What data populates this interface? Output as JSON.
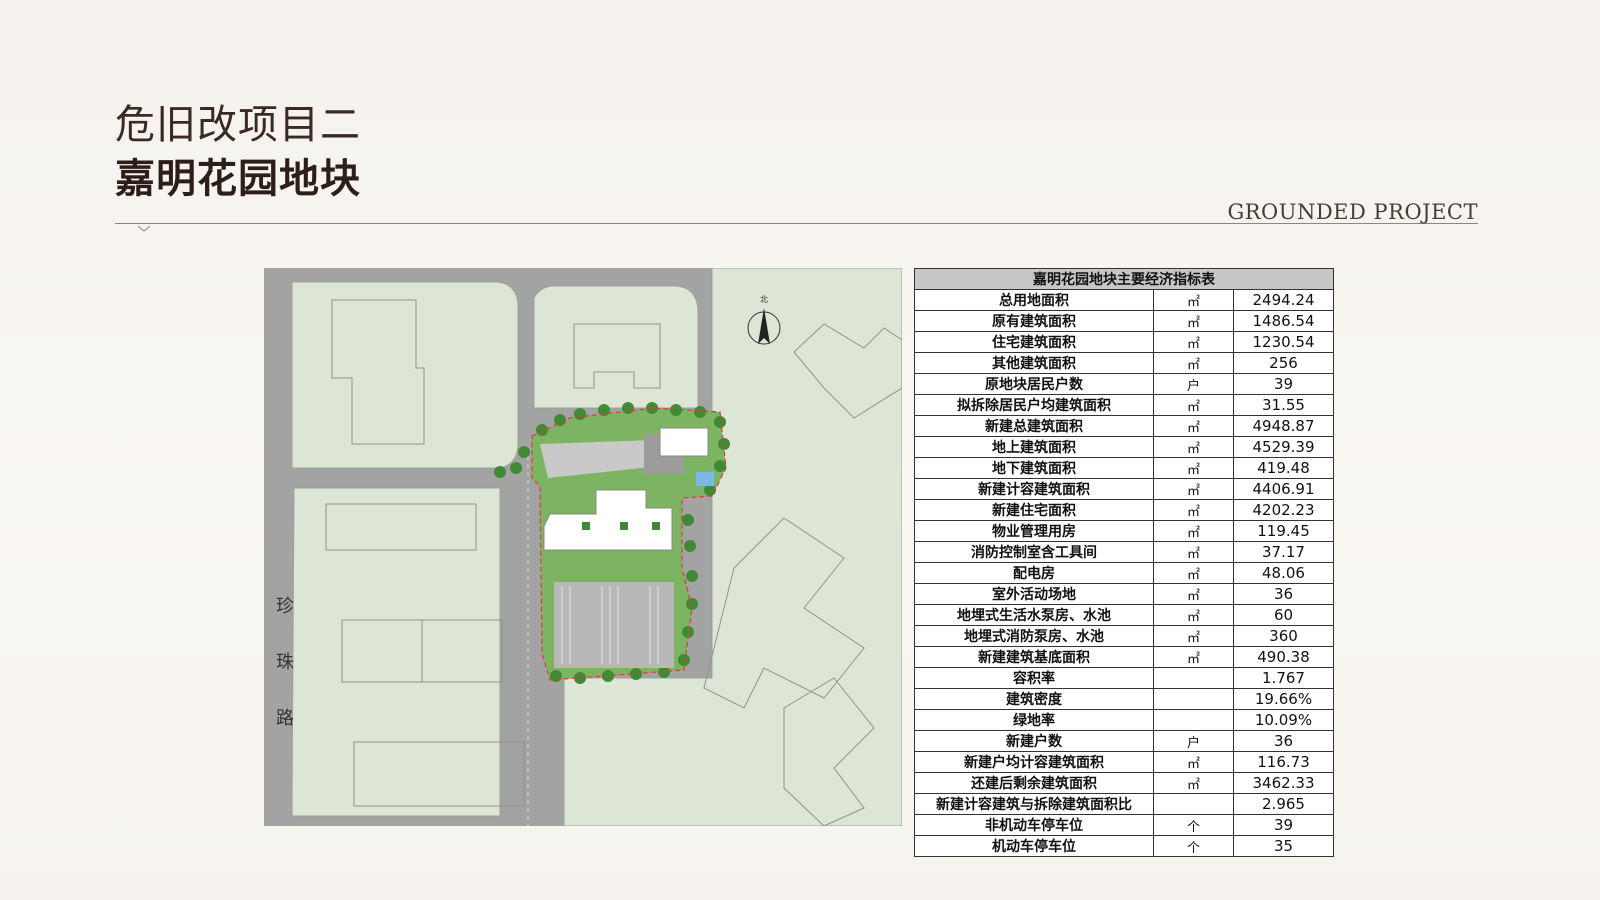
{
  "header": {
    "subtitle": "危旧改项目二",
    "title": "嘉明花园地块",
    "brand": "GROUNDED PROJECT"
  },
  "map": {
    "north_label": "北",
    "road_name_chars": [
      "珍",
      "珠",
      "路"
    ]
  },
  "table": {
    "title": "嘉明花园地块主要经济指标表",
    "rows": [
      {
        "name": "总用地面积",
        "unit": "㎡",
        "value": "2494.24"
      },
      {
        "name": "原有建筑面积",
        "unit": "㎡",
        "value": "1486.54"
      },
      {
        "name": "住宅建筑面积",
        "unit": "㎡",
        "value": "1230.54"
      },
      {
        "name": "其他建筑面积",
        "unit": "㎡",
        "value": "256"
      },
      {
        "name": "原地块居民户数",
        "unit": "户",
        "value": "39"
      },
      {
        "name": "拟拆除居民户均建筑面积",
        "unit": "㎡",
        "value": "31.55"
      },
      {
        "name": "新建总建筑面积",
        "unit": "㎡",
        "value": "4948.87"
      },
      {
        "name": "地上建筑面积",
        "unit": "㎡",
        "value": "4529.39"
      },
      {
        "name": "地下建筑面积",
        "unit": "㎡",
        "value": "419.48"
      },
      {
        "name": "新建计容建筑面积",
        "unit": "㎡",
        "value": "4406.91"
      },
      {
        "name": "新建住宅面积",
        "unit": "㎡",
        "value": "4202.23"
      },
      {
        "name": "物业管理用房",
        "unit": "㎡",
        "value": "119.45"
      },
      {
        "name": "消防控制室含工具间",
        "unit": "㎡",
        "value": "37.17"
      },
      {
        "name": "配电房",
        "unit": "㎡",
        "value": "48.06"
      },
      {
        "name": "室外活动场地",
        "unit": "㎡",
        "value": "36"
      },
      {
        "name": "地埋式生活水泵房、水池",
        "unit": "㎡",
        "value": "60"
      },
      {
        "name": "地埋式消防泵房、水池",
        "unit": "㎡",
        "value": "360"
      },
      {
        "name": "新建建筑基底面积",
        "unit": "㎡",
        "value": "490.38"
      },
      {
        "name": "容积率",
        "unit": "",
        "value": "1.767"
      },
      {
        "name": "建筑密度",
        "unit": "",
        "value": "19.66%"
      },
      {
        "name": "绿地率",
        "unit": "",
        "value": "10.09%"
      },
      {
        "name": "新建户数",
        "unit": "户",
        "value": "36"
      },
      {
        "name": "新建户均计容建筑面积",
        "unit": "㎡",
        "value": "116.73"
      },
      {
        "name": "还建后剩余建筑面积",
        "unit": "㎡",
        "value": "3462.33"
      },
      {
        "name": "新建计容建筑与拆除建筑面积比",
        "unit": "",
        "value": "2.965"
      },
      {
        "name": "非机动车停车位",
        "unit": "个",
        "value": "39"
      },
      {
        "name": "机动车停车位",
        "unit": "个",
        "value": "35"
      }
    ]
  }
}
